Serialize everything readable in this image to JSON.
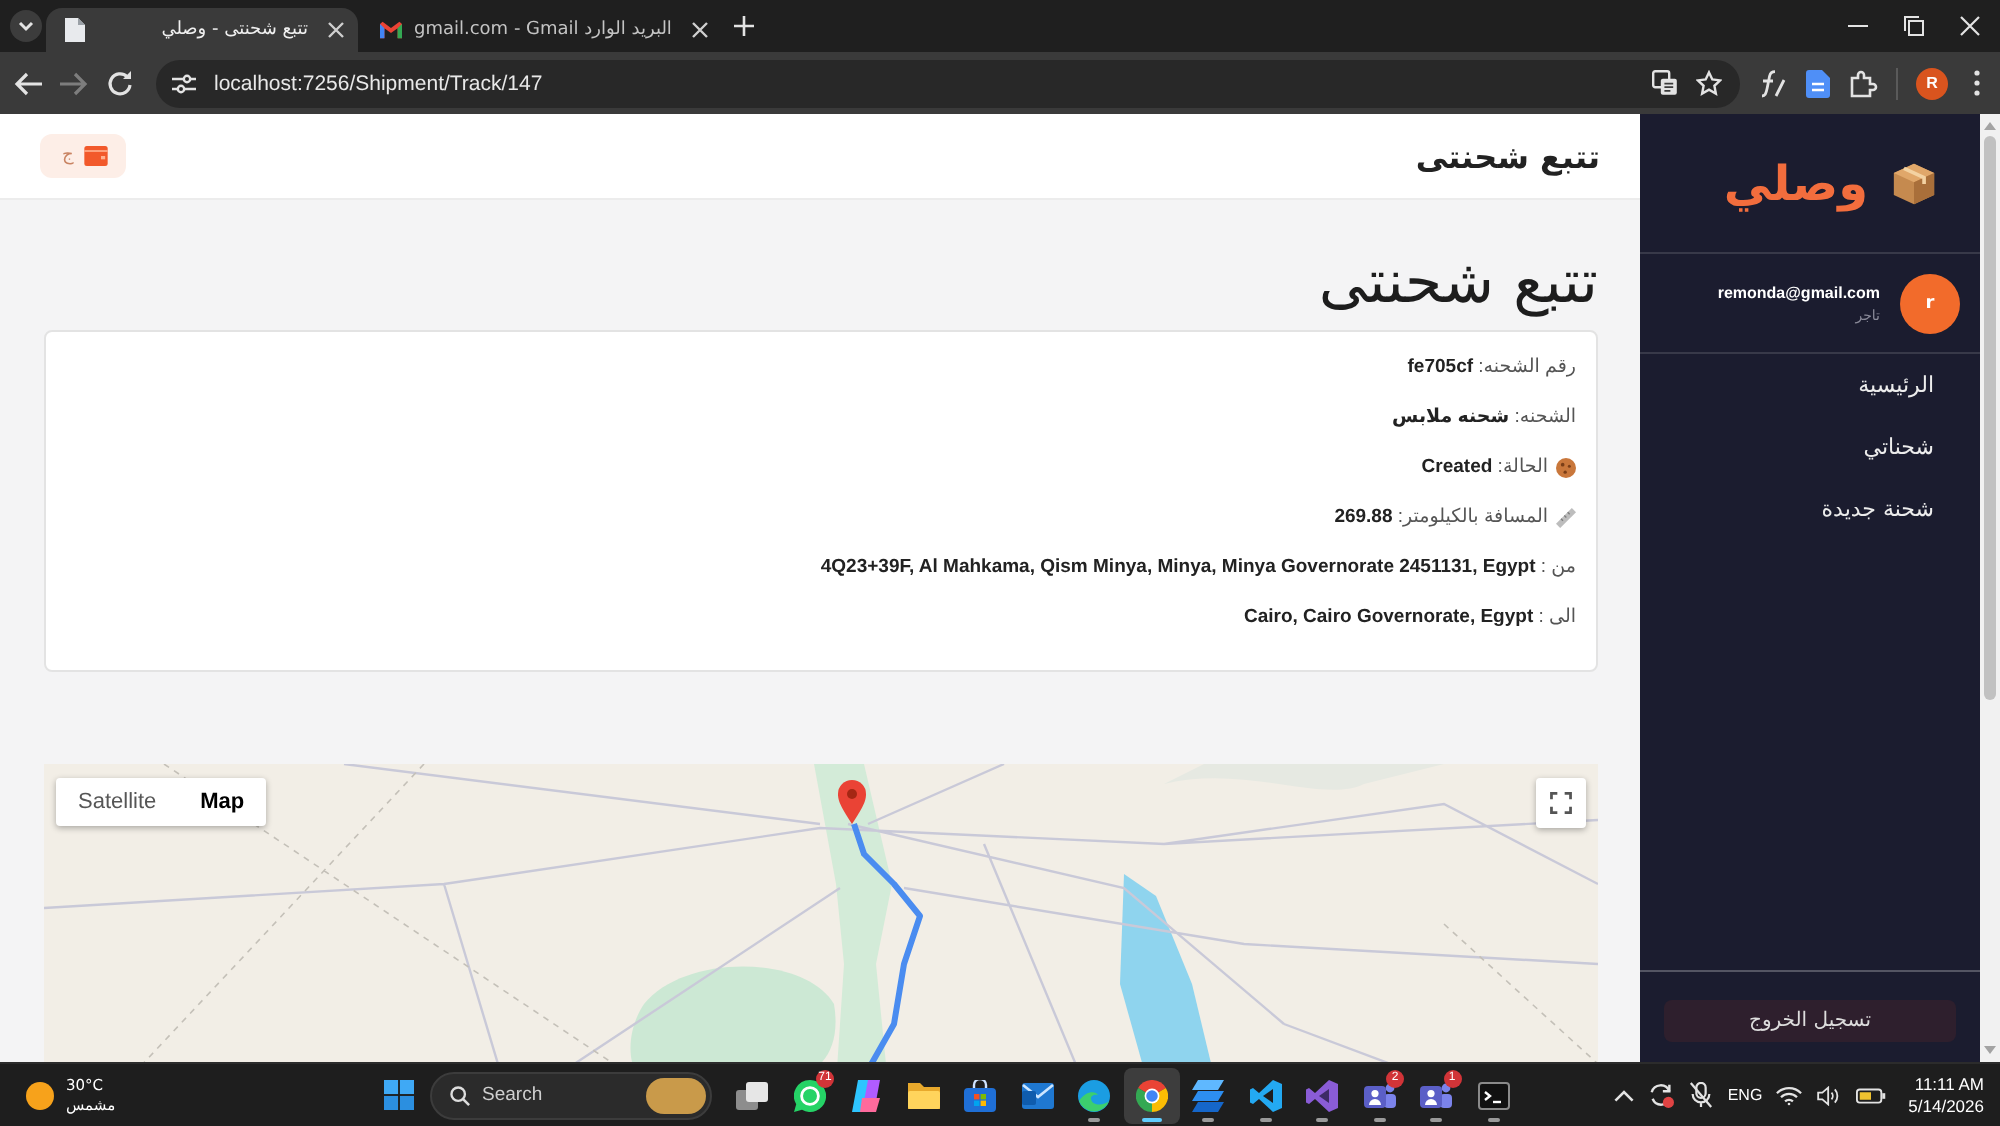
{
  "browser": {
    "tabs": [
      {
        "kind": "mail",
        "title": "gmail.com - Gmail البريد الوارد",
        "selected": false
      },
      {
        "kind": "page",
        "title": "تتبع شحنتى - وصلي",
        "selected": true
      }
    ],
    "forward_disabled": true,
    "address": "localhost:7256/Shipment/Track/147",
    "profile_initial": "R"
  },
  "header": {
    "title": "تتبع شحنتى",
    "button_label": "ج"
  },
  "shipment": {
    "title": "تتبع شحنتى",
    "details": [
      {
        "kind": "plain",
        "text": "رقم الشحنه: **fe705cf**"
      },
      {
        "kind": "plain",
        "text": "الشحنه: **شحنه ملابس**"
      },
      {
        "kind": "status",
        "text": "الحالة: **Created**"
      },
      {
        "kind": "distance",
        "text": "المسافة بالكيلومتر: **269.88**"
      },
      {
        "kind": "plain",
        "text": "من : **4Q23+39F, Al Mahkama, Qism Minya, Minya, Minya Governorate 2451131, Egypt**"
      },
      {
        "kind": "plain",
        "text": "الى : **Cairo, Cairo Governorate, Egypt**"
      }
    ]
  },
  "map": {
    "modes": [
      {
        "label": "Map",
        "selected": true
      },
      {
        "label": "Satellite",
        "selected": false
      }
    ]
  },
  "sidebar": {
    "brand": "وصلي",
    "user": {
      "initial": "r",
      "email": "remonda@gmail.com",
      "role": "تاجر"
    },
    "items": [
      {
        "label": "الرئيسية",
        "selected": false
      },
      {
        "label": "شحناتي",
        "selected": false
      },
      {
        "label": "شحنة جديدة",
        "selected": false
      }
    ],
    "logout": "تسجيل الخروج"
  },
  "taskbar": {
    "weather": {
      "temperature": "30°C",
      "condition": "مشمس"
    },
    "search": {
      "placeholder": "Search"
    },
    "apps": [
      {
        "kind": "terminal",
        "selected": false,
        "running": true
      },
      {
        "kind": "teams",
        "badge": "1",
        "selected": false,
        "running": true
      },
      {
        "kind": "teams",
        "badge": "2",
        "selected": false,
        "running": true
      },
      {
        "kind": "visualstudio",
        "selected": false,
        "running": true
      },
      {
        "kind": "vscode",
        "selected": false,
        "running": true
      },
      {
        "kind": "stack",
        "selected": false,
        "running": true
      },
      {
        "kind": "chrome",
        "selected": true,
        "running": true
      },
      {
        "kind": "edge",
        "selected": false,
        "running": true
      },
      {
        "kind": "outlook",
        "selected": false,
        "running": false
      },
      {
        "kind": "store",
        "selected": false,
        "running": false
      },
      {
        "kind": "explorer",
        "selected": false,
        "running": false
      },
      {
        "kind": "copilot",
        "selected": false,
        "running": false
      },
      {
        "kind": "whatsapp",
        "badge": "71",
        "selected": false,
        "running": false
      },
      {
        "kind": "taskview",
        "selected": false,
        "running": false
      }
    ],
    "language": "ENG",
    "time": "11:11 AM",
    "date": "5/14/2026"
  }
}
